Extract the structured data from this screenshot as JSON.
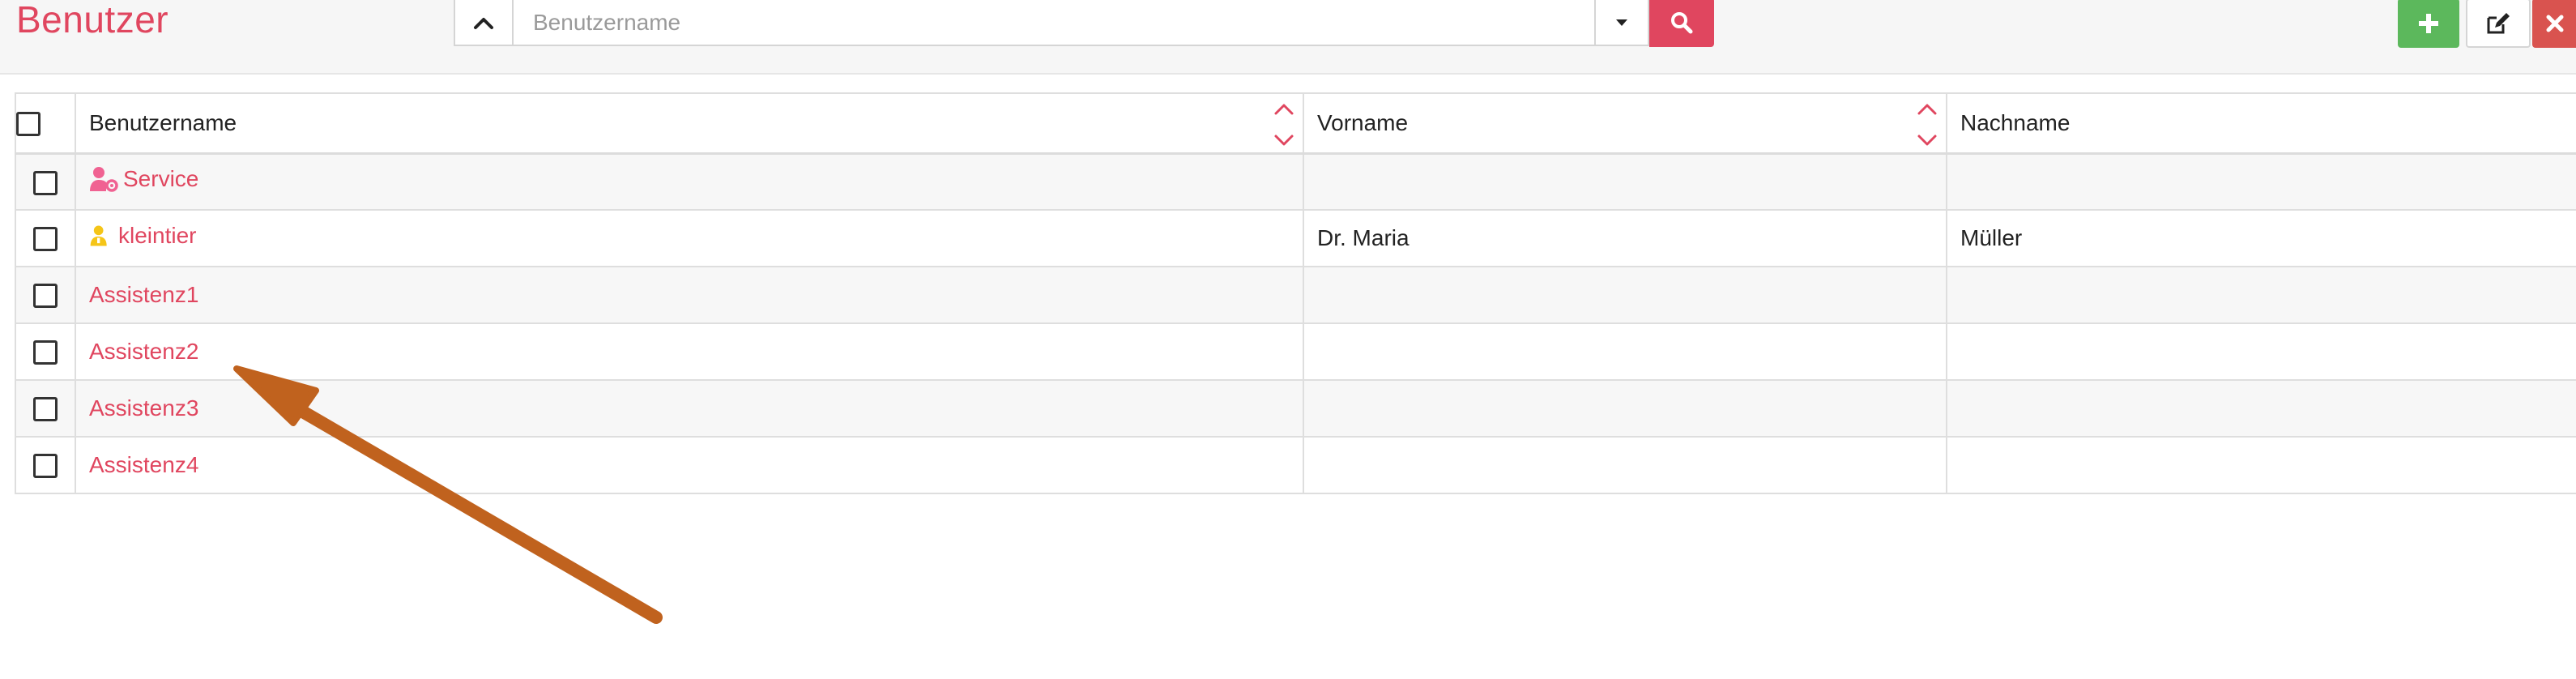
{
  "header": {
    "title": "Benutzer",
    "search_placeholder": "Benutzername",
    "search_value": ""
  },
  "toolbar": {
    "collapse_icon": "chevron-up-icon",
    "dropdown_icon": "caret-down-icon",
    "search_icon": "search-icon",
    "add_icon": "plus-icon",
    "edit_icon": "edit-icon",
    "delete_icon": "close-icon"
  },
  "table": {
    "columns": [
      "Benutzername",
      "Vorname",
      "Nachname"
    ],
    "rows": [
      {
        "username": "Service",
        "icon": "user-gear-icon",
        "icon_color": "#f06292",
        "first_name": "",
        "last_name": ""
      },
      {
        "username": "kleintier",
        "icon": "user-icon",
        "icon_color": "#f5c518",
        "first_name": "Dr. Maria",
        "last_name": "Müller"
      },
      {
        "username": "Assistenz1",
        "icon": "",
        "first_name": "",
        "last_name": ""
      },
      {
        "username": "Assistenz2",
        "icon": "",
        "first_name": "",
        "last_name": ""
      },
      {
        "username": "Assistenz3",
        "icon": "",
        "first_name": "",
        "last_name": ""
      },
      {
        "username": "Assistenz4",
        "icon": "",
        "first_name": "",
        "last_name": ""
      }
    ]
  },
  "annotation": {
    "type": "arrow",
    "color": "#c0621e"
  },
  "colors": {
    "accent": "#e0465f",
    "add": "#5cb85c",
    "delete": "#d9534f"
  }
}
